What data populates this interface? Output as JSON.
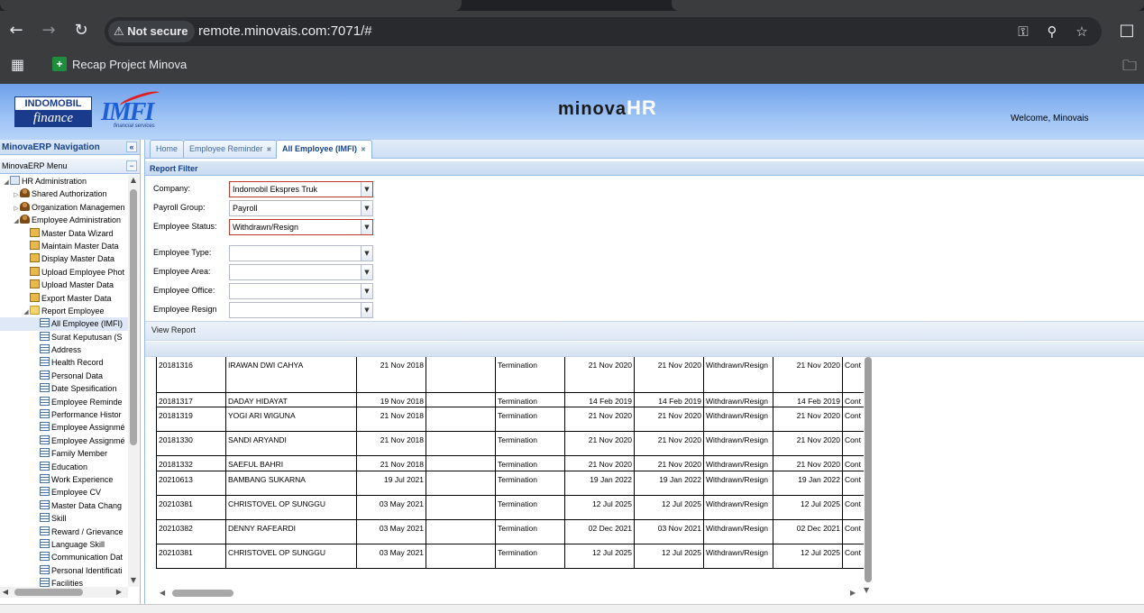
{
  "browser": {
    "security_label": "Not secure",
    "url": "remote.minovais.com:7071/#",
    "bookmark_label": "Recap Project Minova"
  },
  "header": {
    "logo_top": "INDOMOBIL",
    "logo_bottom": "finance",
    "imfi_logo": "IMFI",
    "imfi_sub": "financial services",
    "minova_text": "minova",
    "hr_text": "HR",
    "welcome": "Welcome, Minovais"
  },
  "nav": {
    "title": "MinovaERP Navigation",
    "menu_title": "MinovaERP Menu",
    "items": [
      {
        "label": "HR Administration",
        "level": 0,
        "icon": "grid-icon",
        "expander": "open"
      },
      {
        "label": "Shared Authorization",
        "level": 1,
        "icon": "user-icon",
        "expander": "closed"
      },
      {
        "label": "Organization Managemen",
        "level": 1,
        "icon": "user-icon",
        "expander": "closed"
      },
      {
        "label": "Employee Administration",
        "level": 1,
        "icon": "user-icon",
        "expander": "open"
      },
      {
        "label": "Master Data Wizard",
        "level": 2,
        "icon": "page-icon"
      },
      {
        "label": "Maintain Master Data",
        "level": 2,
        "icon": "page-icon"
      },
      {
        "label": "Display Master Data",
        "level": 2,
        "icon": "page-icon"
      },
      {
        "label": "Upload Employee Phot",
        "level": 2,
        "icon": "page-icon"
      },
      {
        "label": "Upload Master Data",
        "level": 2,
        "icon": "page-icon"
      },
      {
        "label": "Export Master Data",
        "level": 2,
        "icon": "page-icon"
      },
      {
        "label": "Report Employee",
        "level": 2,
        "icon": "folder-icon",
        "expander": "open"
      },
      {
        "label": "All Employee (IMFI)",
        "level": 3,
        "icon": "list-icon",
        "selected": true
      },
      {
        "label": "Surat Keputusan (S",
        "level": 3,
        "icon": "list-icon"
      },
      {
        "label": "Address",
        "level": 3,
        "icon": "list-icon"
      },
      {
        "label": "Health Record",
        "level": 3,
        "icon": "list-icon"
      },
      {
        "label": "Personal Data",
        "level": 3,
        "icon": "list-icon"
      },
      {
        "label": "Date Spesification",
        "level": 3,
        "icon": "list-icon"
      },
      {
        "label": "Employee Reminde",
        "level": 3,
        "icon": "list-icon"
      },
      {
        "label": "Performance Histor",
        "level": 3,
        "icon": "list-icon"
      },
      {
        "label": "Employee Assignmé",
        "level": 3,
        "icon": "list-icon"
      },
      {
        "label": "Employee Assignmé",
        "level": 3,
        "icon": "list-icon"
      },
      {
        "label": "Family Member",
        "level": 3,
        "icon": "list-icon"
      },
      {
        "label": "Education",
        "level": 3,
        "icon": "list-icon"
      },
      {
        "label": "Work Experience",
        "level": 3,
        "icon": "list-icon"
      },
      {
        "label": "Employee CV",
        "level": 3,
        "icon": "list-icon"
      },
      {
        "label": "Master Data Chang",
        "level": 3,
        "icon": "list-icon"
      },
      {
        "label": "Skill",
        "level": 3,
        "icon": "list-icon"
      },
      {
        "label": "Reward / Grievance",
        "level": 3,
        "icon": "list-icon"
      },
      {
        "label": "Language Skill",
        "level": 3,
        "icon": "list-icon"
      },
      {
        "label": "Communication Dat",
        "level": 3,
        "icon": "list-icon"
      },
      {
        "label": "Personal Identificati",
        "level": 3,
        "icon": "list-icon"
      },
      {
        "label": "Facilities",
        "level": 3,
        "icon": "list-icon"
      }
    ]
  },
  "tabs": [
    {
      "label": "Home",
      "closable": false,
      "active": false
    },
    {
      "label": "Employee Reminder",
      "closable": true,
      "active": false
    },
    {
      "label": "All Employee (IMFI)",
      "closable": true,
      "active": true
    }
  ],
  "filter": {
    "title": "Report Filter",
    "fields": [
      {
        "label": "Company:",
        "value": "Indomobil Ekspres Truk",
        "invalid": true
      },
      {
        "label": "Payroll Group:",
        "value": "Payroll",
        "invalid": false
      },
      {
        "label": "Employee Status:",
        "value": "Withdrawn/Resign",
        "invalid": true
      },
      {
        "label": "Employee Type:",
        "value": "",
        "invalid": false
      },
      {
        "label": "Employee Area:",
        "value": "",
        "invalid": false
      },
      {
        "label": "Employee Office:",
        "value": "",
        "invalid": false
      },
      {
        "label": "Employee Resign",
        "value": "",
        "invalid": false
      }
    ],
    "view_button": "View Report"
  },
  "report": {
    "rows": [
      [
        "20181316",
        "IRAWAN DWI CAHYA",
        "21 Nov 2018",
        "",
        "Termination",
        "21 Nov 2020",
        "21 Nov 2020",
        "Withdrawn/Resign",
        "21 Nov 2020",
        "Cont"
      ],
      [
        "20181317",
        "DADAY HIDAYAT",
        "19 Nov 2018",
        "",
        "Termination",
        "14 Feb 2019",
        "14 Feb 2019",
        "Withdrawn/Resign",
        "14 Feb 2019",
        "Cont"
      ],
      [
        "20181319",
        "YOGI ARI WIGUNA",
        "21 Nov 2018",
        "",
        "Termination",
        "21 Nov 2020",
        "21 Nov 2020",
        "Withdrawn/Resign",
        "21 Nov 2020",
        "Cont"
      ],
      [
        "20181330",
        "SANDI ARYANDI",
        "21 Nov 2018",
        "",
        "Termination",
        "21 Nov 2020",
        "21 Nov 2020",
        "Withdrawn/Resign",
        "21 Nov 2020",
        "Cont"
      ],
      [
        "20181332",
        "SAEFUL BAHRI",
        "21 Nov 2018",
        "",
        "Termination",
        "21 Nov 2020",
        "21 Nov 2020",
        "Withdrawn/Resign",
        "21 Nov 2020",
        "Cont"
      ],
      [
        "20210613",
        "BAMBANG SUKARNA",
        "19 Jul 2021",
        "",
        "Termination",
        "19 Jan 2022",
        "19 Jan 2022",
        "Withdrawn/Resign",
        "19 Jan 2022",
        "Cont"
      ],
      [
        "20210381",
        "CHRISTOVEL OP SUNGGU",
        "03 May 2021",
        "",
        "Termination",
        "12 Jul 2025",
        "12 Jul 2025",
        "Withdrawn/Resign",
        "12 Jul 2025",
        "Cont"
      ],
      [
        "20210382",
        "DENNY RAFEARDI",
        "03 May 2021",
        "",
        "Termination",
        "02 Dec 2021",
        "03 Nov 2021",
        "Withdrawn/Resign",
        "02 Dec 2021",
        "Cont"
      ],
      [
        "20210381",
        "CHRISTOVEL OP SUNGGU",
        "03 May 2021",
        "",
        "Termination",
        "12 Jul 2025",
        "12 Jul 2025",
        "Withdrawn/Resign",
        "12 Jul 2025",
        "Cont"
      ]
    ]
  }
}
